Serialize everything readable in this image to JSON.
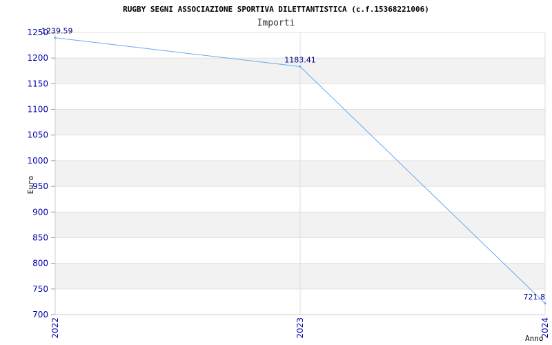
{
  "chart_data": {
    "type": "line",
    "title": "RUGBY SEGNI ASSOCIAZIONE SPORTIVA DILETTANTISTICA (c.f.15368221006)",
    "subtitle": "Importi",
    "xlabel": "Anno",
    "ylabel": "Euro",
    "categories": [
      "2022",
      "2023",
      "2024"
    ],
    "series": [
      {
        "values": [
          1239.59,
          1183.41,
          721.8
        ],
        "labels": [
          "1239.59",
          "1183.41",
          "721.8"
        ]
      }
    ],
    "ylim": [
      700,
      1250
    ],
    "yticks": [
      "700",
      "750",
      "800",
      "850",
      "900",
      "950",
      "1000",
      "1050",
      "1100",
      "1150",
      "1200",
      "1250"
    ],
    "grid": true,
    "line_color": "#66aaee",
    "band_color": "#f2f2f2",
    "tick_color": "#0000aa"
  }
}
